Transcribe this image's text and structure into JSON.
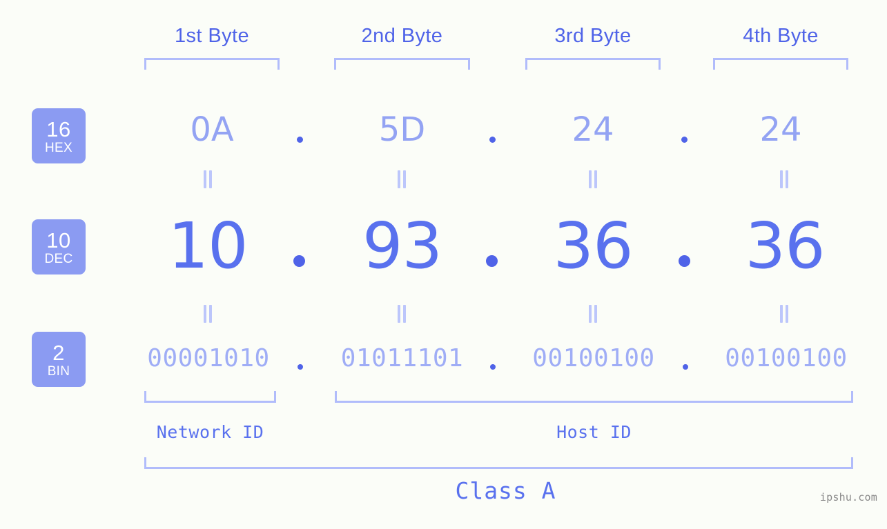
{
  "page": {
    "background_color": "#fbfdf8",
    "accent_color": "#5971ee",
    "badge_color": "#8b9bf2",
    "bracket_color": "#b1bcfb"
  },
  "byte_headers": [
    {
      "label": "1st Byte"
    },
    {
      "label": "2nd Byte"
    },
    {
      "label": "3rd Byte"
    },
    {
      "label": "4th Byte"
    }
  ],
  "rows": {
    "hex": {
      "badge_number": "16",
      "badge_name": "HEX",
      "values": [
        "0A",
        "5D",
        "24",
        "24"
      ],
      "separator": "."
    },
    "dec": {
      "badge_number": "10",
      "badge_name": "DEC",
      "values": [
        "10",
        "93",
        "36",
        "36"
      ],
      "separator": "."
    },
    "bin": {
      "badge_number": "2",
      "badge_name": "BIN",
      "values": [
        "00001010",
        "01011101",
        "00100100",
        "00100100"
      ],
      "separator": "."
    }
  },
  "equals_symbol": "=",
  "id_labels": [
    {
      "label": "Network ID"
    },
    {
      "label": "Host ID"
    }
  ],
  "class_label": "Class A",
  "watermark": "ipshu.com"
}
